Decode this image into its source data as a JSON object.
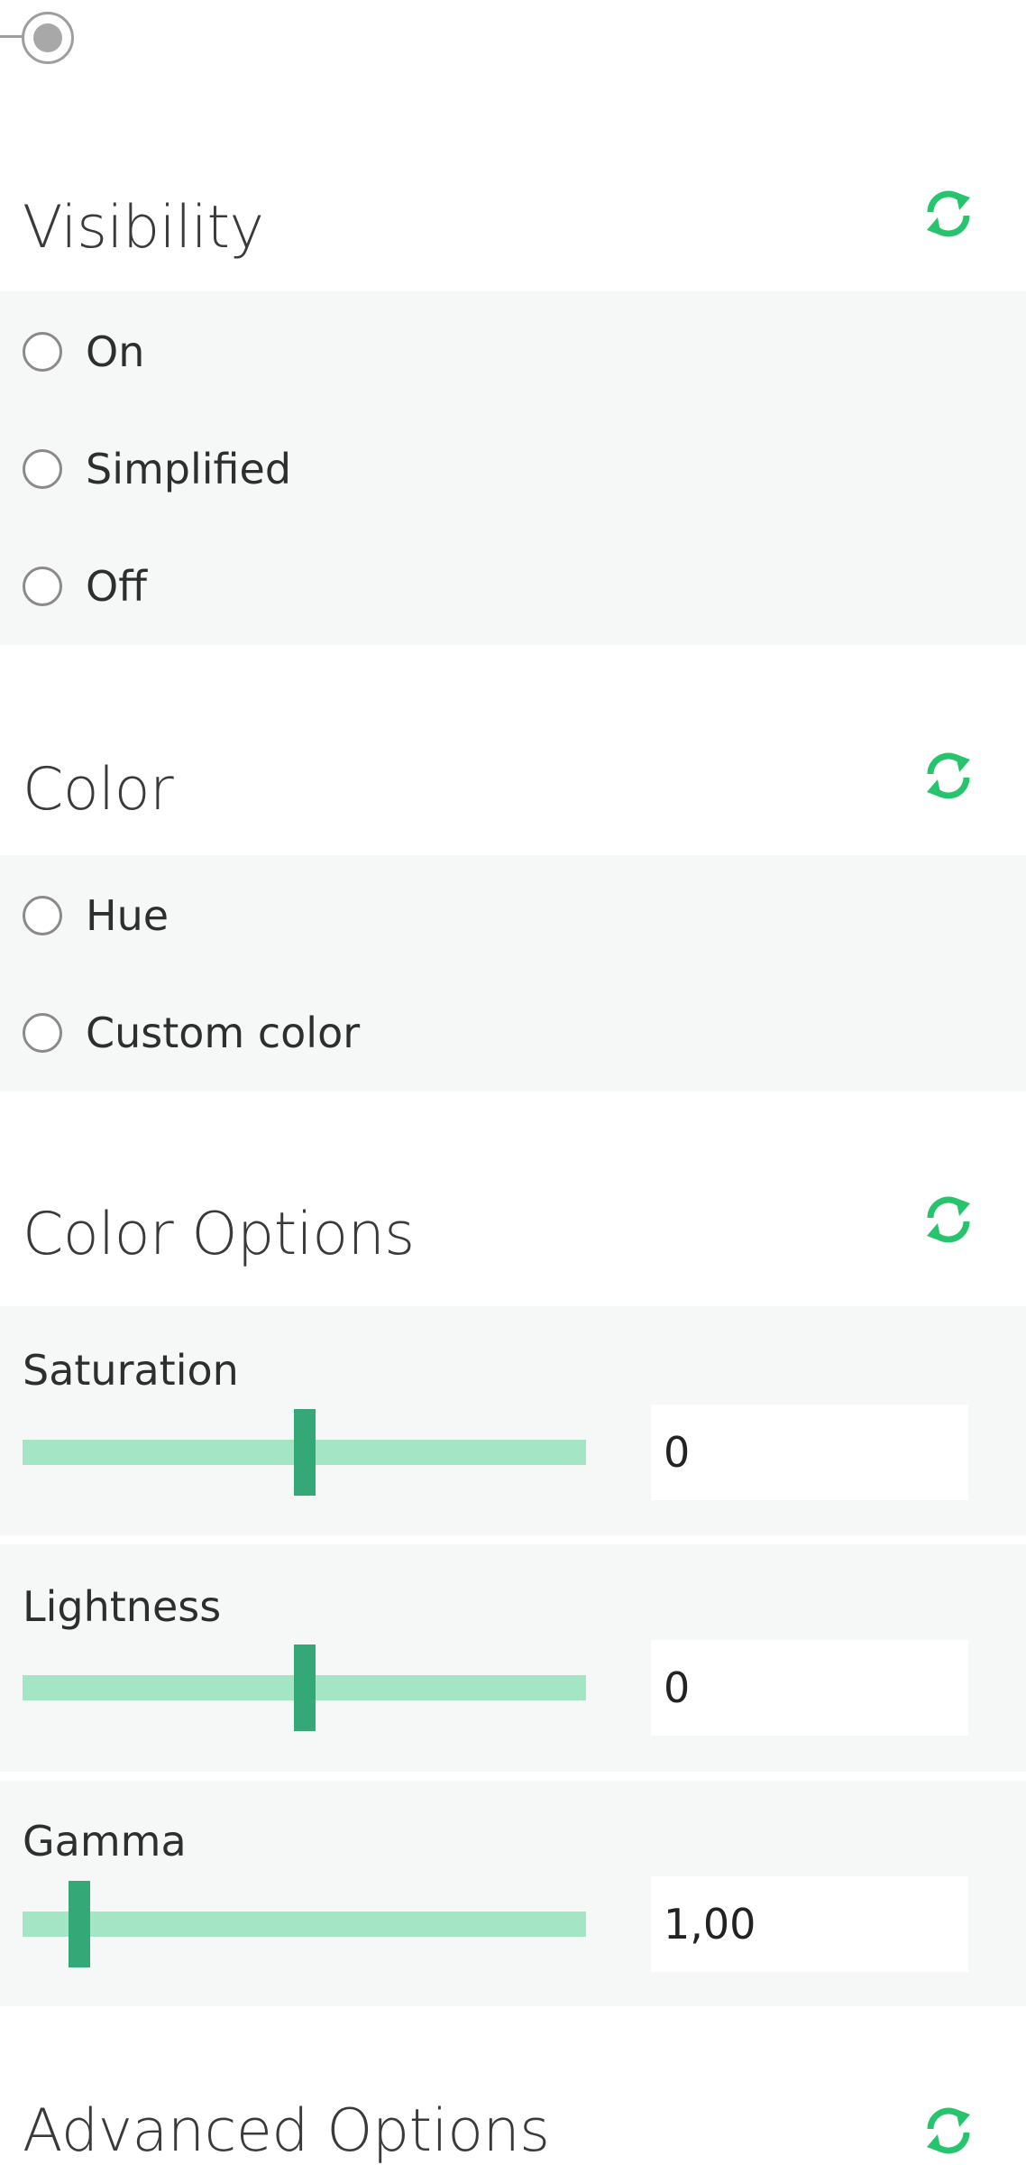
{
  "sections": {
    "visibility": {
      "title": "Visibility",
      "options": [
        "On",
        "Simplified",
        "Off"
      ]
    },
    "color": {
      "title": "Color",
      "options": [
        "Hue",
        "Custom color"
      ]
    },
    "color_options": {
      "title": "Color Options",
      "sliders": [
        {
          "label": "Saturation",
          "value": "0",
          "level": 0.5
        },
        {
          "label": "Lightness",
          "value": "0",
          "level": 0.5
        },
        {
          "label": "Gamma",
          "value": "1,00",
          "level": 0.1
        }
      ]
    },
    "advanced": {
      "title": "Advanced Options"
    }
  },
  "colors": {
    "accent": "#27c46e",
    "track": "#a4e5c6",
    "thumb": "#34a877",
    "panel": "#f5f8f7"
  },
  "icons": {
    "refresh": "refresh-icon"
  }
}
